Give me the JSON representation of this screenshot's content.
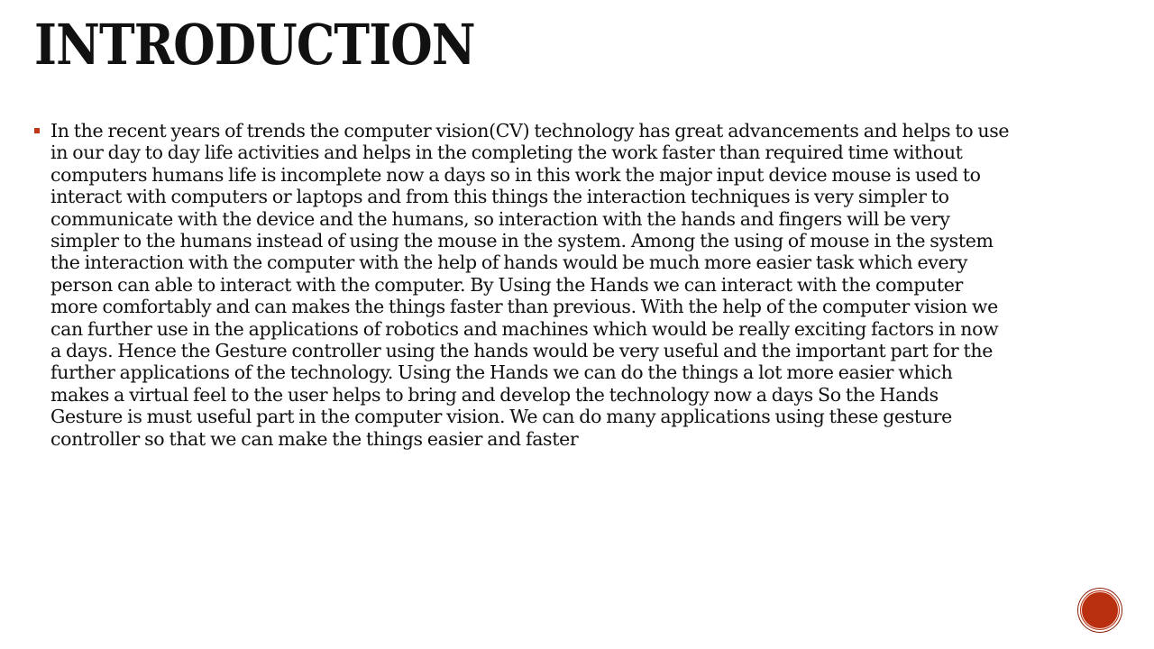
{
  "slide": {
    "title": "INTRODUCTION",
    "bullets": [
      "In the recent years of trends the computer vision(CV) technology has great advancements and helps to use in our day to day life activities and helps in the completing the work faster than required time without computers humans life is incomplete now a days so in this work the major input device mouse is used to interact with computers or laptops and from this things the interaction techniques is very simpler to communicate with the device and the humans, so interaction with the hands and fingers will be very simpler to the humans instead of using the mouse in the system. Among the using of mouse in the system the interaction with the computer with the help of hands would be much more easier task which every person can able to interact with the computer. By Using the Hands we can interact with the computer more comfortably and can makes the things faster than previous. With the help of the computer vision we can further use in the applications of robotics and machines which would be really exciting factors in now a days. Hence the Gesture controller using the hands would be very useful and the important part for the further applications of the technology. Using the Hands we can do the things a lot more easier which makes a virtual feel to the user helps to bring and develop the technology now a days So the Hands Gesture is must useful part in the computer vision. We can do many applications using these gesture controller so that we can make the things easier and faster"
    ]
  },
  "colors": {
    "accent": "#c0381a",
    "badge": "#b8300f",
    "text": "#111111"
  }
}
